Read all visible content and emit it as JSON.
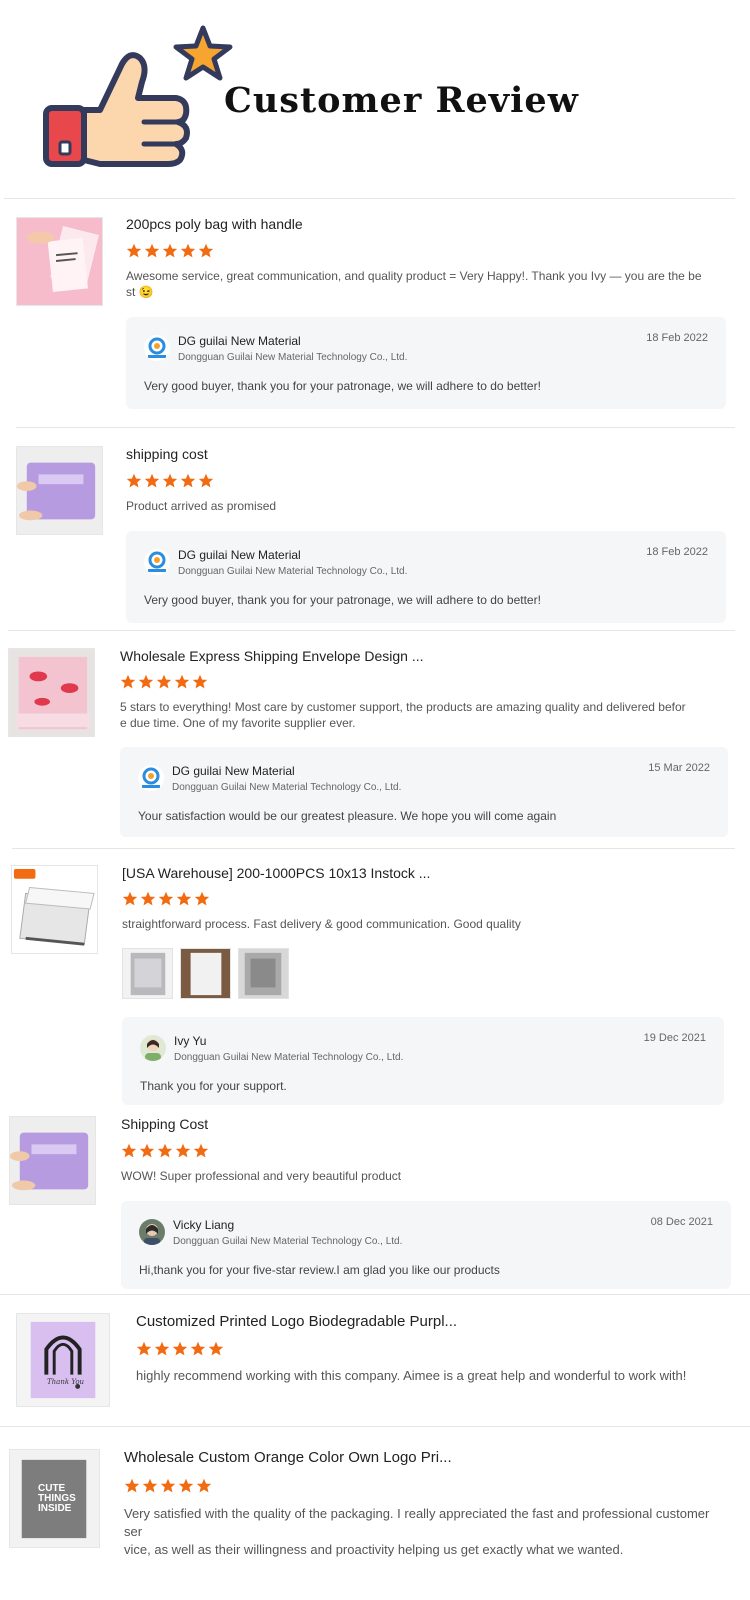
{
  "header": {
    "title": "Customer Review",
    "logo_icon": "thumbs-up-star-icon"
  },
  "colors": {
    "star": "#f26a11",
    "reply_bg": "#f5f6f8",
    "divider": "#e6e6e6"
  },
  "reviews": [
    {
      "product_title": "200pcs poly bag with handle",
      "rating": 5,
      "text_line1": "Awesome service, great communication, and quality product = Very Happy!. Thank you Ivy — you are the be",
      "text_line2": "st 😉",
      "reply": {
        "name": "DG guilai New Material",
        "company": "Dongguan Guilai New Material Technology Co., Ltd.",
        "date": "18 Feb 2022",
        "text": "Very good buyer, thank you for your patronage, we will adhere to do better!"
      }
    },
    {
      "product_title": "shipping cost",
      "rating": 5,
      "text_line1": "Product arrived as promised",
      "reply": {
        "name": "DG guilai New Material",
        "company": "Dongguan Guilai New Material Technology Co., Ltd.",
        "date": "18 Feb 2022",
        "text": "Very good buyer, thank you for your patronage, we will adhere to do better!"
      }
    },
    {
      "product_title": "Wholesale Express Shipping Envelope Design ...",
      "rating": 5,
      "text_line1": "5 stars to everything! Most care by customer support, the products are amazing quality and delivered befor",
      "text_line2": "e due time. One of my favorite supplier ever.",
      "reply": {
        "name": "DG guilai New Material",
        "company": "Dongguan Guilai New Material Technology Co., Ltd.",
        "date": "15 Mar 2022",
        "text": "Your satisfaction would be our greatest pleasure. We hope you will come again"
      }
    },
    {
      "product_title": "[USA Warehouse] 200-1000PCS 10x13 Instock ...",
      "rating": 5,
      "text_line1": "straightforward process. Fast delivery & good communication. Good quality",
      "reply": {
        "name": "Ivy Yu",
        "company": "Dongguan Guilai New Material Technology Co., Ltd.",
        "date": "19 Dec 2021",
        "text": "Thank you for your support."
      }
    },
    {
      "product_title": "Shipping Cost",
      "rating": 5,
      "text_line1": "WOW!  Super professional and very beautiful product",
      "reply": {
        "name": "Vicky Liang",
        "company": "Dongguan Guilai New Material Technology Co., Ltd.",
        "date": "08 Dec 2021",
        "text": "Hi,thank you for your five-star review.I am glad you like our products"
      }
    },
    {
      "product_title": "Customized Printed Logo Biodegradable Purpl...",
      "rating": 5,
      "text_line1": "highly recommend working with this company. Aimee is a great help and wonderful to work with!"
    },
    {
      "product_title": "Wholesale Custom Orange Color Own Logo Pri...",
      "rating": 5,
      "text_line1": "Very satisfied with the quality of the packaging. I really appreciated the fast and professional customer ser",
      "text_line2": "vice, as well as their willingness and proactivity helping us get exactly what we wanted."
    }
  ],
  "images": {
    "r6_bag_text": "Thank You",
    "r7_bag_text_1": "CUTE",
    "r7_bag_text_2": "THINGS",
    "r7_bag_text_3": "INSIDE"
  }
}
